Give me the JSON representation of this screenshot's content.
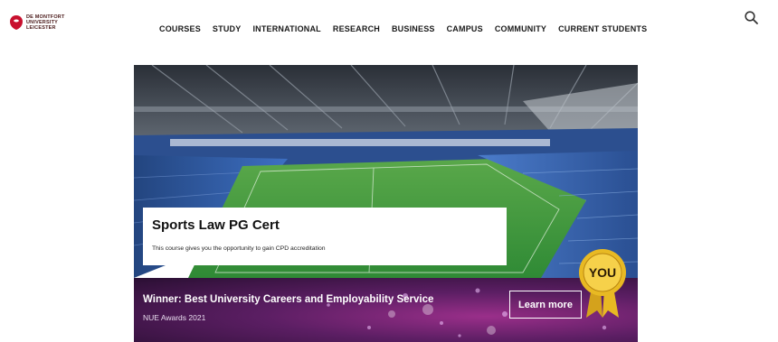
{
  "header": {
    "logo": {
      "line1": "DE MONTFORT",
      "line2": "UNIVERSITY",
      "line3": "LEICESTER"
    },
    "nav": [
      "COURSES",
      "STUDY",
      "INTERNATIONAL",
      "RESEARCH",
      "BUSINESS",
      "CAMPUS",
      "COMMUNITY",
      "CURRENT STUDENTS"
    ],
    "search_icon": "search-icon"
  },
  "hero": {
    "card_title": "Sports Law PG Cert",
    "card_description": "This course gives you the opportunity to gain CPD accreditation",
    "award_title": "Winner: Best University Careers and Employability Service",
    "award_subtitle": "NUE Awards 2021",
    "learn_more_label": "Learn more",
    "badge_text": "YOU",
    "colors": {
      "award_bg": "#5b1e63",
      "pitch": "#3f9a3a",
      "seats": "#2f5fb3",
      "badge_gold": "#e8b923"
    }
  }
}
